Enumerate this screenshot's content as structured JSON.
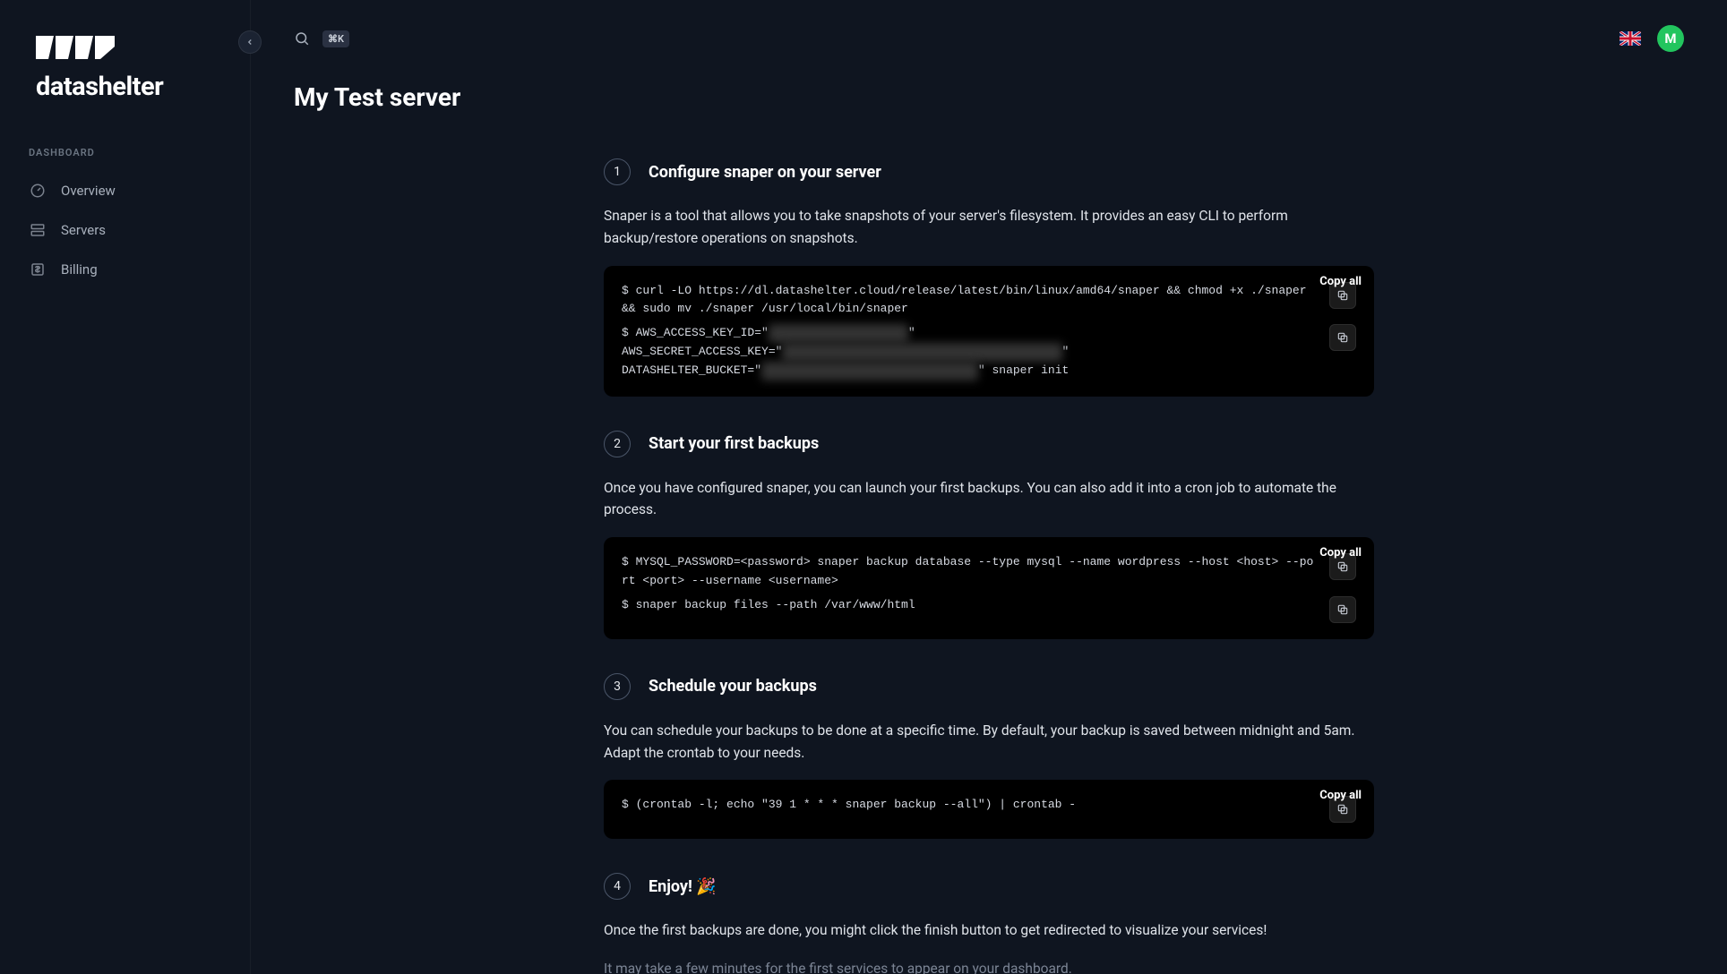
{
  "brand": {
    "name": "datashelter"
  },
  "sidebar": {
    "section_label": "DASHBOARD",
    "items": [
      {
        "label": "Overview",
        "name": "overview"
      },
      {
        "label": "Servers",
        "name": "servers"
      },
      {
        "label": "Billing",
        "name": "billing"
      }
    ]
  },
  "topbar": {
    "shortcut": "⌘K",
    "avatar_initial": "M"
  },
  "page": {
    "title": "My Test server"
  },
  "copy_all_label": "Copy all",
  "steps": [
    {
      "num": "1",
      "title": "Configure snaper on your server",
      "desc": "Snaper is a tool that allows you to take snapshots of your server's filesystem. It provides an easy CLI to perform backup/restore operations on snapshots.",
      "commands": [
        {
          "prefix": "$ curl -LO https://dl.datashelter.cloud/release/latest/bin/linux/amd64/snaper && chmod +x ./snaper && sudo mv ./snaper /usr/local/bin/snaper",
          "secret": "",
          "suffix": ""
        },
        {
          "prefix": "$ AWS_ACCESS_KEY_ID=\"",
          "secret": "XXXXXXXXXXXXXXXXXXXX",
          "suffix": "\"",
          "more_lines": [
            {
              "prefix": "AWS_SECRET_ACCESS_KEY=\"",
              "secret": "xxxxxxxxxxxxxxxxxxxxxxxxxxxxxxxxxxxxxxxx",
              "suffix": "\""
            },
            {
              "prefix": "DATASHELTER_BUCKET=\"",
              "secret": "xxxxxxxxxxxxxxxxxxxxxxxxxxxxxxx",
              "suffix": "\" snaper init"
            }
          ]
        }
      ]
    },
    {
      "num": "2",
      "title": "Start your first backups",
      "desc": "Once you have configured snaper, you can launch your first backups. You can also add it into a cron job to automate the process.",
      "commands": [
        {
          "prefix": "$ MYSQL_PASSWORD=<password> snaper backup database --type mysql --name wordpress --host <host> --port <port> --username <username>",
          "secret": "",
          "suffix": ""
        },
        {
          "prefix": "$ snaper backup files --path /var/www/html",
          "secret": "",
          "suffix": ""
        }
      ]
    },
    {
      "num": "3",
      "title": "Schedule your backups",
      "desc": "You can schedule your backups to be done at a specific time. By default, your backup is saved between midnight and 5am. Adapt the crontab to your needs.",
      "commands": [
        {
          "prefix": "$ (crontab -l; echo \"39 1 * * * snaper backup --all\") | crontab -",
          "secret": "",
          "suffix": ""
        }
      ]
    },
    {
      "num": "4",
      "title": "Enjoy! 🎉",
      "desc": "Once the first backups are done, you might click the finish button to get redirected to visualize your services!",
      "note": "It may take a few minutes for the first services to appear on your dashboard.",
      "commands": []
    }
  ]
}
